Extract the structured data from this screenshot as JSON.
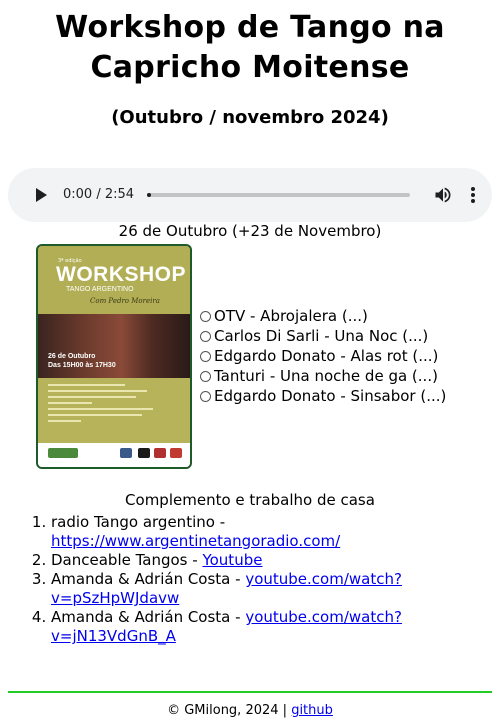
{
  "page": {
    "title": "Workshop de Tango na Capricho Moitense",
    "subtitle": "(Outubro / novembro 2024)"
  },
  "player": {
    "time": "0:00 / 2:54",
    "progress": 0
  },
  "session": {
    "heading": "26 de Outubro (+23 de Novembro)",
    "poster": {
      "badge": "3ª edição",
      "headline": "WORKSHOP",
      "sub": "TANGO ARGENTINO",
      "with": "Com Pedro Moreira",
      "date_line1": "26 de Outubro",
      "date_line2": "Das 15H00 às 17H30"
    },
    "tracks": [
      {
        "label": "OTV - Abrojalera (...)"
      },
      {
        "label": "Carlos Di Sarli - Una Noc (...)"
      },
      {
        "label": "Edgardo Donato - Alas rot (...)"
      },
      {
        "label": "Tanturi - Una noche de ga (...)"
      },
      {
        "label": "Edgardo Donato - Sinsabor (...)"
      }
    ]
  },
  "complement": {
    "heading": "Complemento e trabalho de casa",
    "items": [
      {
        "text": "radio Tango argentino - ",
        "link": "https://www.argentinetangoradio.com/"
      },
      {
        "text": "Danceable Tangos - ",
        "link": "Youtube"
      },
      {
        "text": "Amanda & Adrián Costa - ",
        "link": "youtube.com/watch?v=pSzHpWJdavw"
      },
      {
        "text": "Amanda & Adrián Costa - ",
        "link": "youtube.com/watch?v=jN13VdGnB_A"
      }
    ]
  },
  "footer": {
    "copyright": "© GMilong, 2024 | ",
    "link": "github",
    "accent_color": "#22cc22"
  }
}
